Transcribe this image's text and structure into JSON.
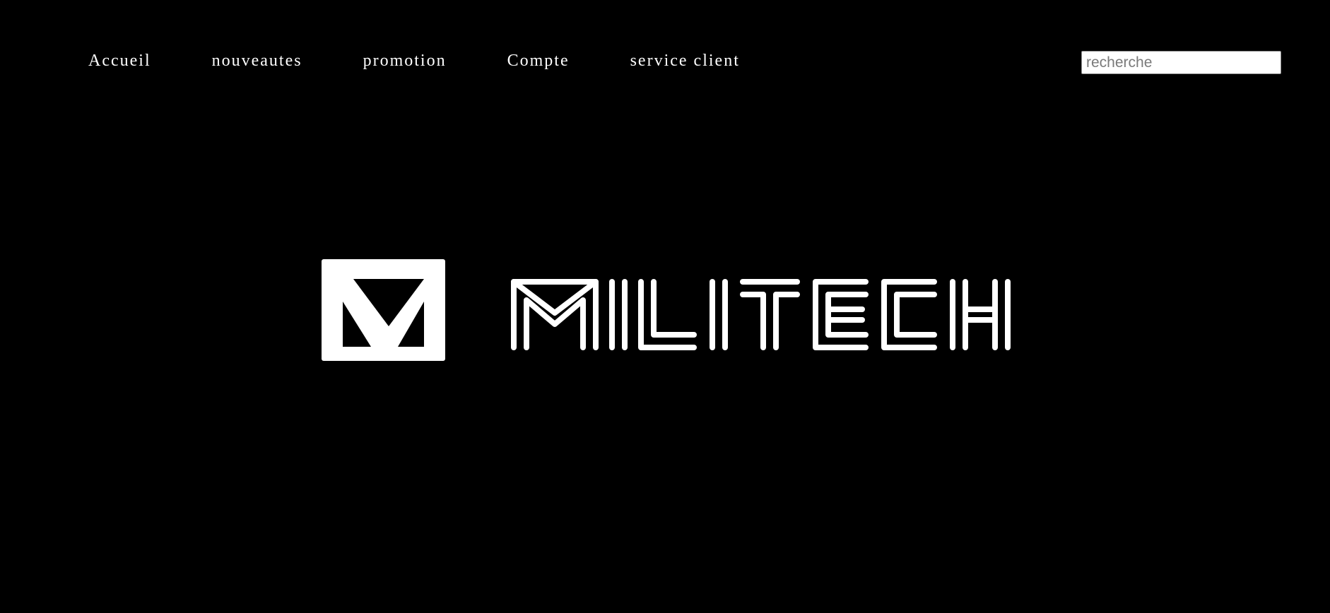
{
  "nav": {
    "items": [
      {
        "label": "Accueil",
        "name": "nav-accueil"
      },
      {
        "label": "nouveautes",
        "name": "nav-nouveautes"
      },
      {
        "label": "promotion",
        "name": "nav-promotion"
      },
      {
        "label": "Compte",
        "name": "nav-compte"
      },
      {
        "label": "service client",
        "name": "nav-service-client"
      }
    ]
  },
  "search": {
    "placeholder": "recherche",
    "value": ""
  },
  "logo": {
    "text": "MILITECH",
    "icon": "militech-v-icon",
    "color": "#ffffff"
  },
  "colors": {
    "background": "#000000",
    "text": "#ffffff"
  }
}
